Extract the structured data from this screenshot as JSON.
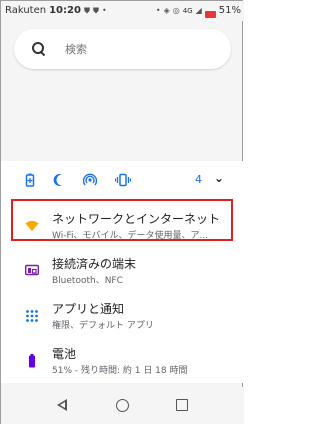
{
  "status_bar": {
    "carrier": "Rakuten",
    "time": "10:20",
    "network": "4G",
    "battery": "51%"
  },
  "search": {
    "placeholder": "検索"
  },
  "quick_settings": {
    "icons": [
      "battery-saver-icon",
      "dark-theme-icon",
      "hotspot-icon",
      "vibrate-icon"
    ],
    "count": "4"
  },
  "settings_list": [
    {
      "icon": "wifi-icon",
      "icon_color": "#f9ab00",
      "title": "ネットワークとインターネット",
      "subtitle": "Wi-Fi、モバイル、データ使用量、ア..."
    },
    {
      "icon": "connected-devices-icon",
      "icon_color": "#7b1fa2",
      "title": "接続済みの端末",
      "subtitle": "Bluetooth、NFC"
    },
    {
      "icon": "apps-icon",
      "icon_color": "#1a73e8",
      "title": "アプリと通知",
      "subtitle": "権限、デフォルト アプリ"
    },
    {
      "icon": "battery-icon",
      "icon_color": "#6200ee",
      "title": "電池",
      "subtitle": "51% - 残り時間: 約 1 日 18 時間"
    }
  ],
  "colors": {
    "accent": "#1a73e8",
    "highlight_border": "#e02020"
  }
}
